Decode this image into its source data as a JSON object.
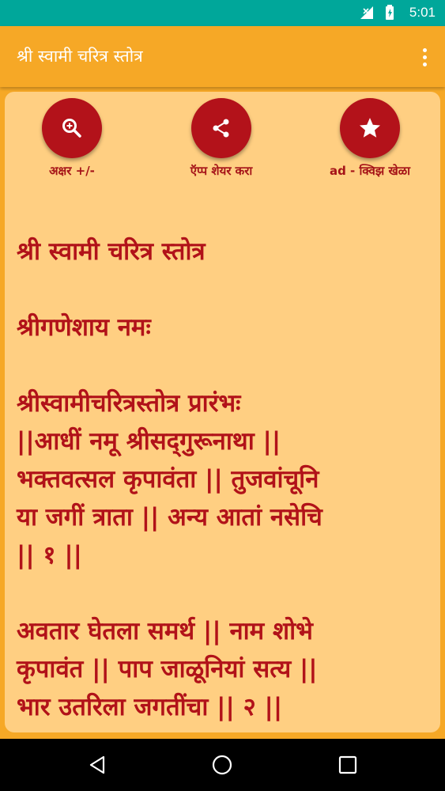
{
  "status_bar": {
    "time": "5:01",
    "icons": [
      "signal-off-icon",
      "battery-charging-icon"
    ]
  },
  "app_bar": {
    "title": "श्री स्वामी चरित्र स्तोत्र",
    "overflow_icon": "more-vert-icon"
  },
  "actions": [
    {
      "label": "अक्षर +/-",
      "icon": "zoom-in-icon"
    },
    {
      "label": "ऍप्प शेयर करा",
      "icon": "share-icon"
    },
    {
      "label": "ad - क्विझ खेळा",
      "icon": "star-icon"
    }
  ],
  "colors": {
    "accent": "#f6a826",
    "card": "#ffcf82",
    "text": "#b11219",
    "fab": "#b3121a",
    "status": "#00a79a"
  },
  "content": {
    "heading": "श्री स्वामी चरित्र स्तोत्र",
    "invocation": "श्रीगणेशाय नमः",
    "verse1": [
      "श्रीस्वामीचरित्रस्तोत्र प्रारंभः",
      "||आधीं नमू श्रीसद्‌गुरूनाथा ||",
      "भक्तवत्सल कृपावंता || तुजवांचूनि",
      "या जगीं त्राता || अन्य आतां नसेचि",
      "|| १ ||"
    ],
    "verse2": [
      "अवतार घेतला समर्थ || नाम शोभे",
      "कृपावंत || पाप जाळूनियां सत्य ||",
      "भार उतरिला जगतींचा || २ ||"
    ]
  },
  "nav": [
    "back-icon",
    "home-icon",
    "recents-icon"
  ]
}
